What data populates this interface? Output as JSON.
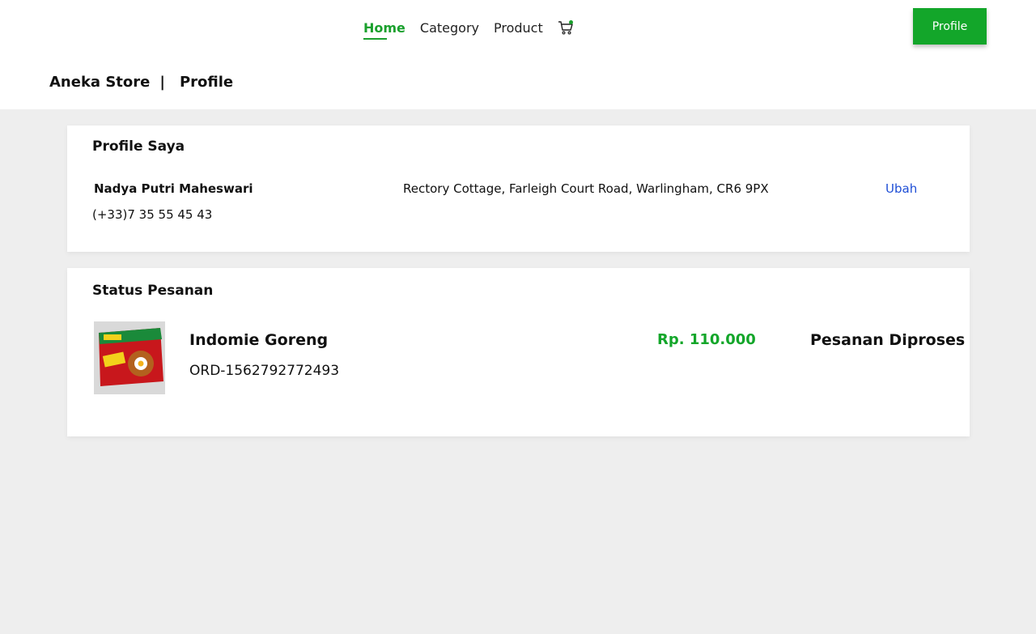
{
  "nav": {
    "items": [
      {
        "label": "Home",
        "active": true
      },
      {
        "label": "Category",
        "active": false
      },
      {
        "label": "Product",
        "active": false
      }
    ],
    "cart_icon": "shopping-cart-icon"
  },
  "header": {
    "profile_button": "Profile"
  },
  "breadcrumb": {
    "store": "Aneka Store",
    "separator": "|",
    "page": "Profile"
  },
  "profile": {
    "title": "Profile Saya",
    "name": "Nadya Putri Maheswari",
    "phone": "(+33)7 35 55 45 43",
    "address": "Rectory Cottage, Farleigh Court Road, Warlingham, CR6 9PX",
    "edit_label": "Ubah"
  },
  "orders": {
    "title": "Status Pesanan",
    "items": [
      {
        "product_name": "Indomie Goreng",
        "order_id": "ORD-1562792772493",
        "price": "Rp. 110.000",
        "status": "Pesanan Diproses"
      }
    ]
  },
  "colors": {
    "accent": "#13a62a",
    "link": "#1f4fd6",
    "background": "#eeeeee"
  }
}
